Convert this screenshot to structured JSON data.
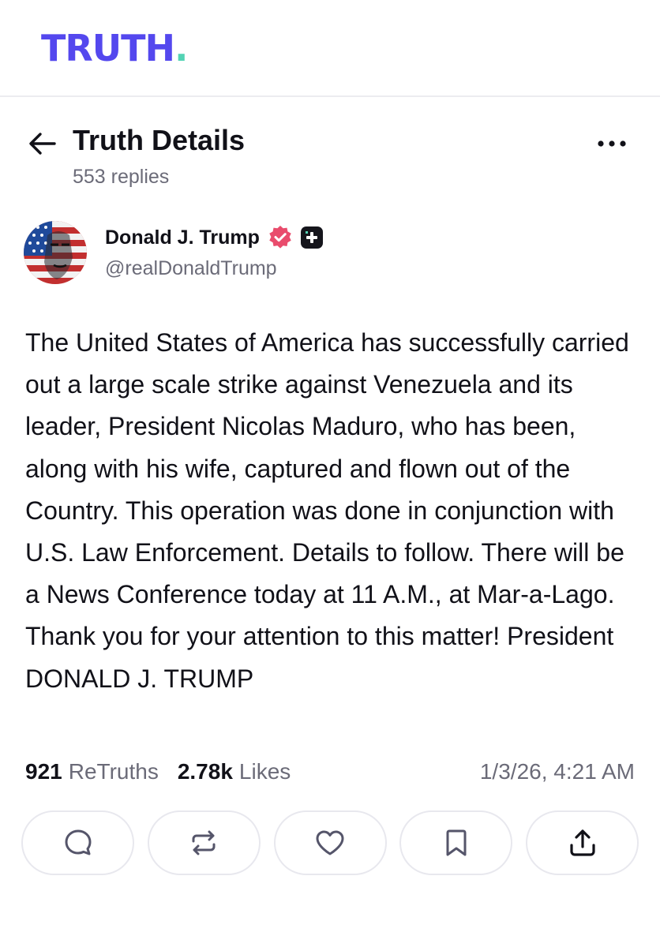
{
  "app": {
    "logo_text": "TRUTH",
    "logo_dot": ".",
    "brand_color": "#5448ee",
    "accent_color": "#53d3b4"
  },
  "header": {
    "back_icon": "arrow-left-icon",
    "title": "Truth Details",
    "replies": "553 replies",
    "more_icon": "ellipsis-icon"
  },
  "author": {
    "name": "Donald J. Trump",
    "handle": "@realDonaldTrump",
    "verified_icon": "verified-badge-icon",
    "verified_color": "#e94c6d",
    "plus_icon": "truth-plus-badge-icon"
  },
  "post": {
    "text": "The United States of America has successfully carried out a large scale strike against Venezuela and its leader, President Nicolas Maduro, who has been, along with his wife, captured and flown out of the Country. This operation was done in conjunction with U.S. Law Enforcement. Details to follow. There will be a News Conference today at 11 A.M., at Mar-a-Lago. Thank you for your attention to this matter! President DONALD J. TRUMP"
  },
  "stats": {
    "retruths_count": "921",
    "retruths_label": "ReTruths",
    "likes_count": "2.78k",
    "likes_label": "Likes",
    "timestamp": "1/3/26, 4:21 AM"
  },
  "actions": [
    {
      "icon": "reply-icon"
    },
    {
      "icon": "retruth-icon"
    },
    {
      "icon": "like-icon"
    },
    {
      "icon": "bookmark-icon"
    },
    {
      "icon": "share-icon"
    }
  ]
}
